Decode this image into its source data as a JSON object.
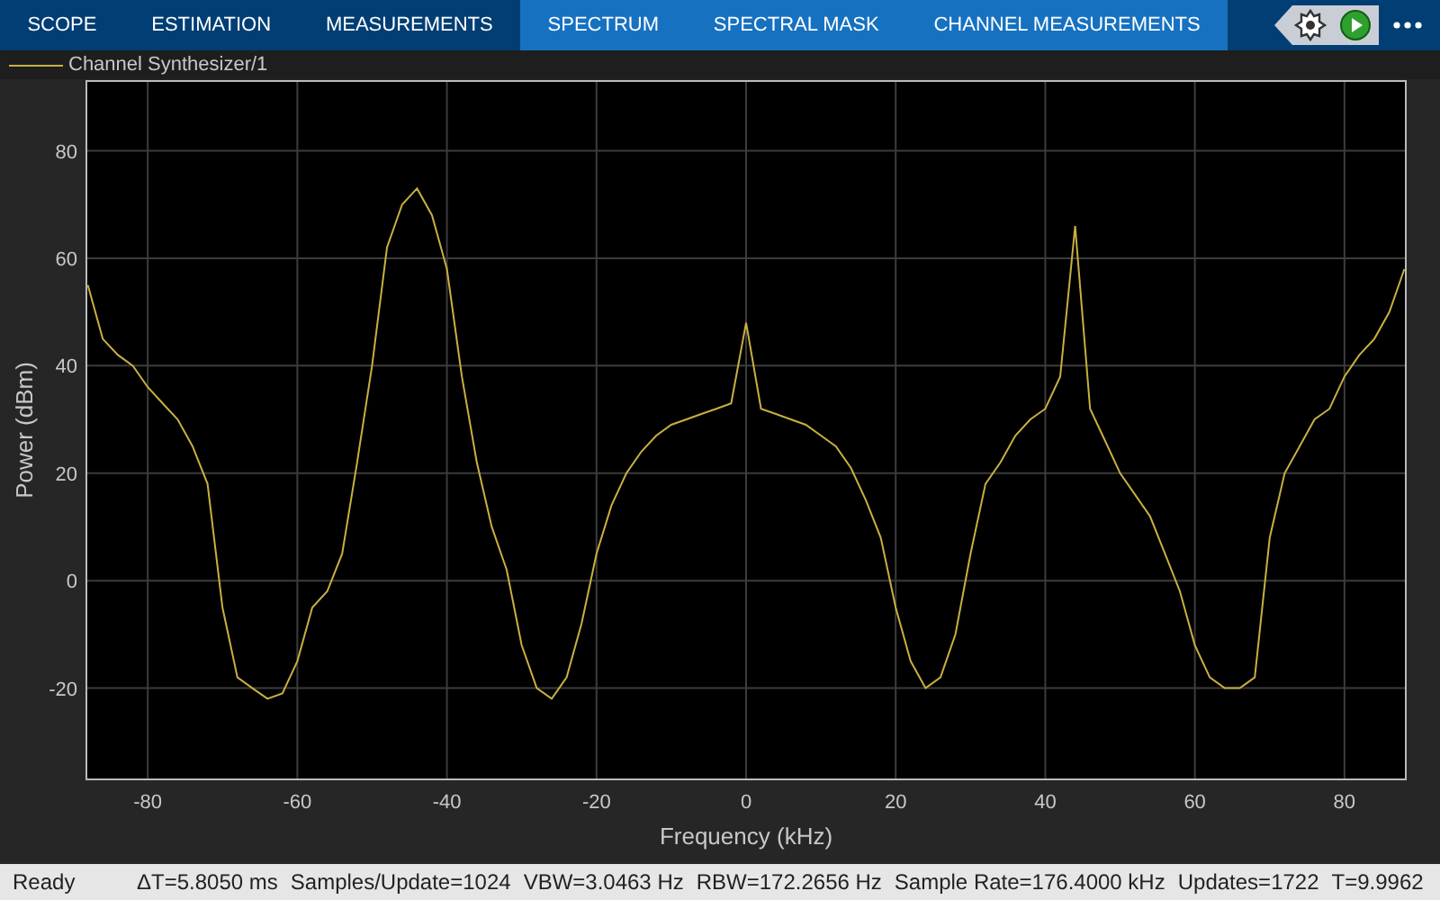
{
  "tabs": [
    {
      "label": "SCOPE",
      "contextual": false
    },
    {
      "label": "ESTIMATION",
      "contextual": false
    },
    {
      "label": "MEASUREMENTS",
      "contextual": false
    },
    {
      "label": "SPECTRUM",
      "contextual": true
    },
    {
      "label": "SPECTRAL MASK",
      "contextual": true
    },
    {
      "label": "CHANNEL MEASUREMENTS",
      "contextual": true
    }
  ],
  "chart_data": {
    "type": "line",
    "grid": true,
    "xlabel": "Frequency (kHz)",
    "ylabel": "Power (dBm)",
    "xlim": [
      -88.2,
      88.2
    ],
    "ylim": [
      -37,
      93
    ],
    "xticks": [
      -80,
      -60,
      -40,
      -20,
      0,
      20,
      40,
      60,
      80
    ],
    "yticks": [
      -20,
      0,
      20,
      40,
      60,
      80
    ],
    "x": [
      -88,
      -86,
      -84,
      -82,
      -80,
      -78,
      -76,
      -74,
      -72,
      -70,
      -68,
      -66,
      -64,
      -62,
      -60,
      -58,
      -56,
      -54,
      -52,
      -50,
      -48,
      -46,
      -44,
      -42,
      -40,
      -38,
      -36,
      -34,
      -32,
      -30,
      -28,
      -26,
      -24,
      -22,
      -20,
      -18,
      -16,
      -14,
      -12,
      -10,
      -8,
      -6,
      -4,
      -2,
      0,
      2,
      4,
      6,
      8,
      10,
      12,
      14,
      16,
      18,
      20,
      22,
      24,
      26,
      28,
      30,
      32,
      34,
      36,
      38,
      40,
      42,
      44,
      46,
      48,
      50,
      52,
      54,
      56,
      58,
      60,
      62,
      64,
      66,
      68,
      70,
      72,
      74,
      76,
      78,
      80,
      82,
      84,
      86,
      88
    ],
    "series": [
      {
        "name": "Channel Synthesizer/1",
        "color": "#c8b040",
        "values": [
          55,
          45,
          42,
          40,
          36,
          33,
          30,
          25,
          18,
          -5,
          -18,
          -20,
          -22,
          -21,
          -15,
          -5,
          -2,
          5,
          22,
          40,
          62,
          70,
          73,
          68,
          58,
          38,
          22,
          10,
          2,
          -12,
          -20,
          -22,
          -18,
          -8,
          5,
          14,
          20,
          24,
          27,
          29,
          30,
          31,
          32,
          33,
          48,
          32,
          31,
          30,
          29,
          27,
          25,
          21,
          15,
          8,
          -5,
          -15,
          -20,
          -18,
          -10,
          5,
          18,
          22,
          27,
          30,
          32,
          38,
          66,
          32,
          26,
          20,
          16,
          12,
          5,
          -2,
          -12,
          -18,
          -20,
          -20,
          -18,
          8,
          20,
          25,
          30,
          32,
          38,
          42,
          45,
          50,
          58
        ]
      }
    ]
  },
  "status": [
    "Ready",
    "ΔT=5.8050 ms",
    "Samples/Update=1024",
    "VBW=3.0463 Hz",
    "RBW=172.2656 Hz",
    "Sample Rate=176.4000 kHz",
    "Updates=1722",
    "T=9.9962"
  ]
}
